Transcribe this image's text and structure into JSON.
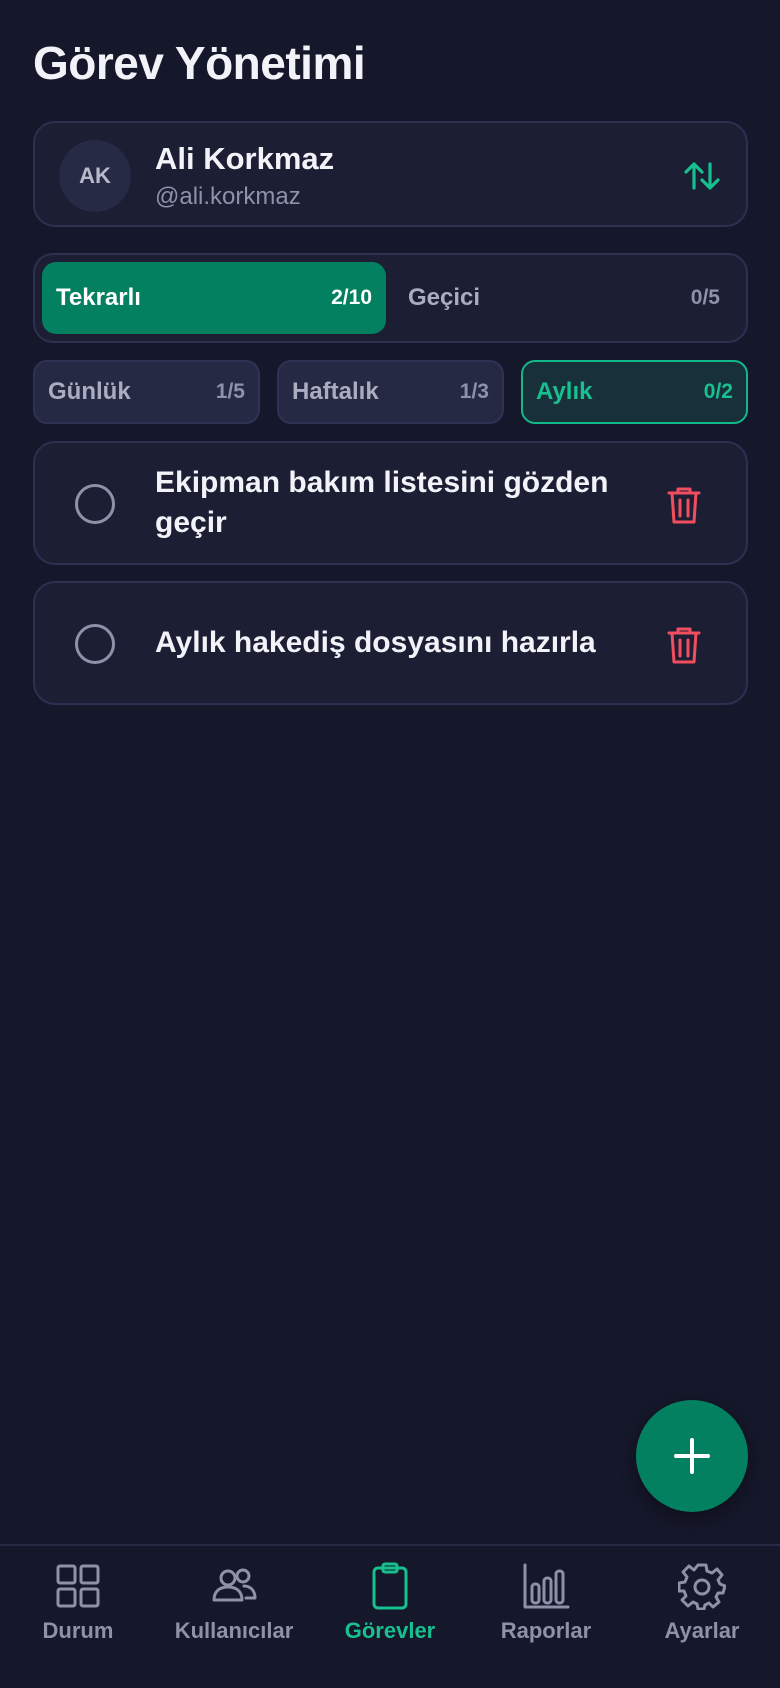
{
  "page": {
    "title": "Görev Yönetimi"
  },
  "user": {
    "initials": "AK",
    "name": "Ali Korkmaz",
    "handle": "@ali.korkmaz",
    "switch_icon": "sort-arrows-icon"
  },
  "segments": [
    {
      "label": "Tekrarlı",
      "count": "2/10",
      "active": true
    },
    {
      "label": "Geçici",
      "count": "0/5",
      "active": false
    }
  ],
  "periods": [
    {
      "label": "Günlük",
      "count": "1/5",
      "active": false
    },
    {
      "label": "Haftalık",
      "count": "1/3",
      "active": false
    },
    {
      "label": "Aylık",
      "count": "0/2",
      "active": true
    }
  ],
  "tasks": [
    {
      "text": "Ekipman bakım listesini gözden geçir",
      "done": false
    },
    {
      "text": "Aylık hakediş dosyasını hazırla",
      "done": false
    }
  ],
  "fab": {
    "icon": "plus-icon"
  },
  "nav": [
    {
      "label": "Durum",
      "icon": "grid-icon",
      "active": false
    },
    {
      "label": "Kullanıcılar",
      "icon": "users-icon",
      "active": false
    },
    {
      "label": "Görevler",
      "icon": "clipboard-icon",
      "active": true
    },
    {
      "label": "Raporlar",
      "icon": "bar-chart-icon",
      "active": false
    },
    {
      "label": "Ayarlar",
      "icon": "gear-icon",
      "active": false
    }
  ],
  "colors": {
    "accent": "#028060",
    "accent_text": "#18c08f",
    "danger": "#f24e5f",
    "background": "#15172a",
    "card": "#1c1e33"
  }
}
